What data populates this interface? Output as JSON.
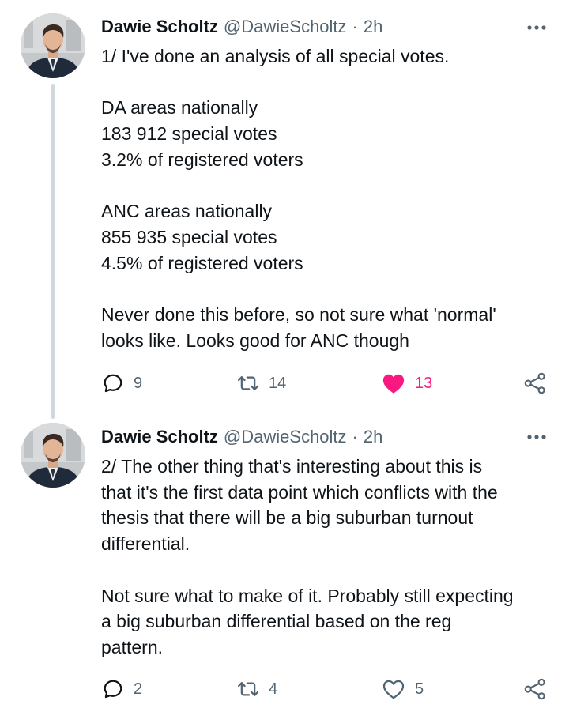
{
  "colors": {
    "text": "#0f1419",
    "secondary": "#536471",
    "like_active": "#f91880",
    "thread_line": "#cfd9de"
  },
  "tweets": [
    {
      "author": {
        "name": "Dawie Scholtz",
        "handle": "@DawieScholtz"
      },
      "separator": "·",
      "time": "2h",
      "more_icon": "more-horizontal-icon",
      "lines": [
        "1/ I've done an analysis of all  special votes.",
        "",
        "DA areas nationally",
        "183 912 special votes",
        "3.2% of registered voters",
        "",
        "ANC areas nationally",
        "855 935 special votes",
        "4.5% of registered voters",
        "",
        "Never done this before, so not sure what 'normal'",
        "looks like. Looks good for ANC though"
      ],
      "stats": {
        "replies": "9",
        "retweets": "14",
        "likes": "13"
      },
      "liked": true
    },
    {
      "author": {
        "name": "Dawie Scholtz",
        "handle": "@DawieScholtz"
      },
      "separator": "·",
      "time": "2h",
      "more_icon": "more-horizontal-icon",
      "lines": [
        "2/ The other thing that's interesting about this is",
        "that it's the first data point which conflicts with the",
        "thesis that there will be a big suburban turnout",
        "differential.",
        "",
        "Not sure what to make of it. Probably still expecting",
        "a big suburban differential based on the reg",
        "pattern."
      ],
      "stats": {
        "replies": "2",
        "retweets": "4",
        "likes": "5"
      },
      "liked": false
    }
  ]
}
